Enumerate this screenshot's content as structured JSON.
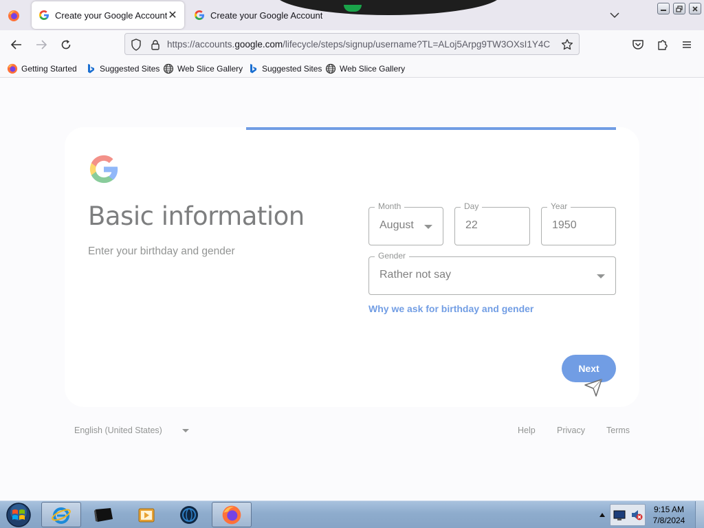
{
  "browser": {
    "tabs": [
      {
        "title": "Create your Google Account",
        "active": true
      },
      {
        "title": "Create your Google Account",
        "active": false
      }
    ],
    "url": {
      "prefix": "https://accounts.",
      "domain": "google.com",
      "path": "/lifecycle/steps/signup/username?TL=ALoj5Arpg9TW3OXsI1Y4C"
    },
    "bookmarks": [
      {
        "label": "Getting Started",
        "icon": "firefox-icon"
      },
      {
        "label": "Suggested Sites",
        "icon": "bing-icon"
      },
      {
        "label": "Web Slice Gallery",
        "icon": "globe-icon"
      },
      {
        "label": "Suggested Sites",
        "icon": "bing-icon"
      },
      {
        "label": "Web Slice Gallery",
        "icon": "globe-icon"
      }
    ]
  },
  "signup": {
    "title": "Basic information",
    "subtitle": "Enter your birthday and gender",
    "progress_fraction": 0.7,
    "month": {
      "label": "Month",
      "value": "August"
    },
    "day": {
      "label": "Day",
      "value": "22"
    },
    "year": {
      "label": "Year",
      "value": "1950"
    },
    "gender": {
      "label": "Gender",
      "value": "Rather not say"
    },
    "why_link": "Why we ask for birthday and gender",
    "next_label": "Next"
  },
  "footer": {
    "language": "English (United States)",
    "links": [
      "Help",
      "Privacy",
      "Terms"
    ]
  },
  "taskbar": {
    "time": "9:15 AM",
    "date": "7/8/2024",
    "apps": [
      "internet-explorer-icon",
      "terminal-icon",
      "media-player-icon",
      "network-globe-icon",
      "firefox-icon"
    ]
  },
  "colors": {
    "accent": "#0b57d0",
    "page_background": "#f8f9fb"
  }
}
